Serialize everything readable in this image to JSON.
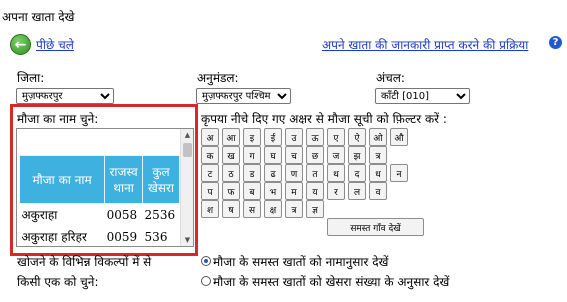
{
  "page": {
    "title": "अपना खाता देखे",
    "back_label": "पीछे चले",
    "process_link": "अपने खाता की जानकारी प्राप्त करने की प्रक्रिया"
  },
  "filters": {
    "district_label": "जिला:",
    "district_value": "मुज़फ्फरपुर",
    "subdivision_label": "अनुमंडल:",
    "subdivision_value": "मुज़फ्फरपुर पश्चिम",
    "circle_label": "अंचल:",
    "circle_value": "काँटी [010]"
  },
  "mauza": {
    "label": "मौजा का नाम चुने:",
    "headers": [
      "मौजा का नाम",
      "राजस्व थाना",
      "कुल खेसरा"
    ],
    "rows": [
      {
        "name": "अकुराहा",
        "thana": "0058",
        "khesra": "2536"
      },
      {
        "name": "अकुराहा हरिहर",
        "thana": "0059",
        "khesra": "536"
      }
    ]
  },
  "letter_filter": {
    "label": "कृपया नीचे दिए गए अक्षर से मौजा सूची को फ़िल्टर करें :",
    "rows": [
      [
        "अ",
        "आ",
        "इ",
        "ई",
        "उ",
        "ऊ",
        "ए",
        "ऐ",
        "ओ",
        "औ"
      ],
      [
        "क",
        "ख",
        "ग",
        "घ",
        "च",
        "छ",
        "ज",
        "झ",
        "त्र"
      ],
      [
        "ट",
        "ठ",
        "ड",
        "ढ",
        "ण",
        "त",
        "थ",
        "द",
        "ध",
        "न"
      ],
      [
        "प",
        "फ",
        "ब",
        "भ",
        "म",
        "य",
        "र",
        "ल",
        "व"
      ],
      [
        "श",
        "ष",
        "स",
        "क्ष",
        "त्र",
        "ज्ञ"
      ]
    ],
    "show_all": "समस्त गाँव देखें"
  },
  "options": {
    "label_line1": "खोजने के विभिन्न विकल्पों में से",
    "label_line2": "किसी एक को चुने:",
    "radio1": "मौजा के समस्त खातों को नामानुसार देखें",
    "radio2": "मौजा के समस्त खातों को खेसरा संख्या के अनुसार देखें",
    "selected": "radio1"
  }
}
